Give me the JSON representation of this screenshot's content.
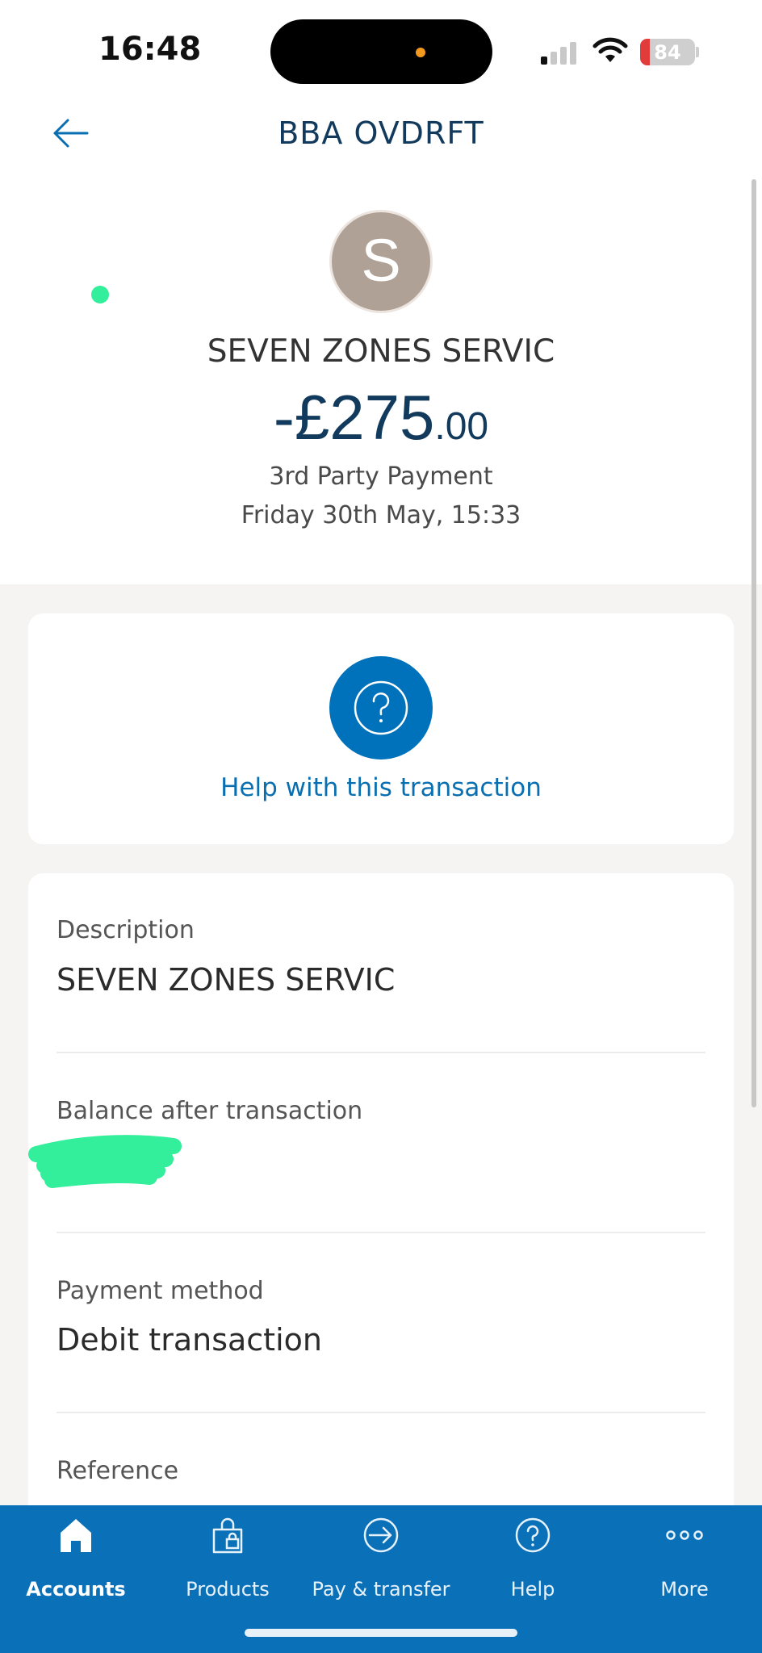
{
  "status_bar": {
    "time": "16:48",
    "battery": "84"
  },
  "header": {
    "title": "BBA OVDRFT",
    "back_icon": "arrow-left-icon"
  },
  "transaction": {
    "avatar_letter": "S",
    "merchant": "SEVEN ZONES SERVIC",
    "amount_main": "-£275",
    "amount_decimal": ".00",
    "type": "3rd Party Payment",
    "date": "Friday 30th May, 15:33"
  },
  "help": {
    "icon": "question-circle-icon",
    "label": "Help with this transaction"
  },
  "details": {
    "description_label": "Description",
    "description_value": "SEVEN ZONES SERVIC",
    "balance_label": "Balance after transaction",
    "payment_method_label": "Payment method",
    "payment_method_value": "Debit transaction",
    "reference_label": "Reference"
  },
  "tabs": [
    {
      "label": "Accounts",
      "icon": "home-icon",
      "active": true
    },
    {
      "label": "Products",
      "icon": "shopping-bag-icon",
      "active": false
    },
    {
      "label": "Pay & transfer",
      "icon": "arrow-circle-icon",
      "active": false
    },
    {
      "label": "Help",
      "icon": "question-circle-icon",
      "active": false
    },
    {
      "label": "More",
      "icon": "more-dots-icon",
      "active": false
    }
  ],
  "colors": {
    "brand_blue": "#0a71b9",
    "title_navy": "#123a5c",
    "avatar_bg": "#b0a196",
    "highlight_green": "#33ee9a"
  }
}
